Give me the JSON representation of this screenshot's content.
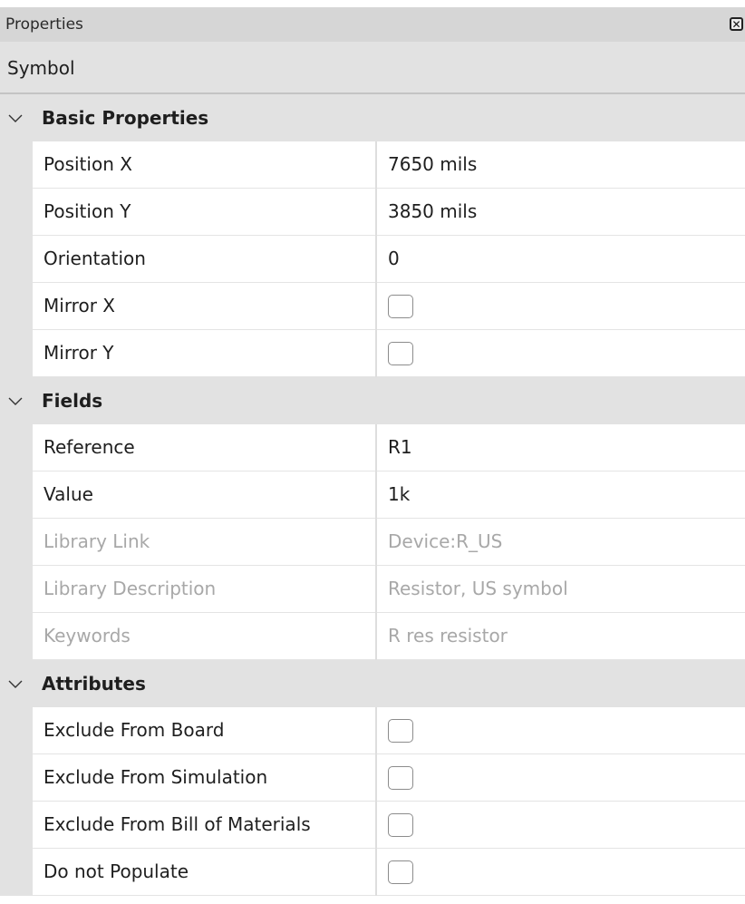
{
  "panel": {
    "title": "Properties",
    "close_icon": "close-icon",
    "subtitle": "Symbol"
  },
  "groups": [
    {
      "label": "Basic Properties",
      "rows": [
        {
          "name": "Position X",
          "value": "7650 mils",
          "type": "text"
        },
        {
          "name": "Position Y",
          "value": "3850 mils",
          "type": "text"
        },
        {
          "name": "Orientation",
          "value": "0",
          "type": "text"
        },
        {
          "name": "Mirror X",
          "checked": false,
          "type": "checkbox"
        },
        {
          "name": "Mirror Y",
          "checked": false,
          "type": "checkbox"
        }
      ]
    },
    {
      "label": "Fields",
      "rows": [
        {
          "name": "Reference",
          "value": "R1",
          "type": "text"
        },
        {
          "name": "Value",
          "value": "1k",
          "type": "text"
        },
        {
          "name": "Library Link",
          "value": "Device:R_US",
          "type": "text",
          "disabled": true
        },
        {
          "name": "Library Description",
          "value": "Resistor, US symbol",
          "type": "text",
          "disabled": true
        },
        {
          "name": "Keywords",
          "value": "R res resistor",
          "type": "text",
          "disabled": true
        }
      ]
    },
    {
      "label": "Attributes",
      "rows": [
        {
          "name": "Exclude From Board",
          "checked": false,
          "type": "checkbox"
        },
        {
          "name": "Exclude From Simulation",
          "checked": false,
          "type": "checkbox"
        },
        {
          "name": "Exclude From Bill of Materials",
          "checked": false,
          "type": "checkbox"
        },
        {
          "name": "Do not Populate",
          "checked": false,
          "type": "checkbox"
        }
      ]
    }
  ],
  "colors": {
    "header_bg": "#d6d6d6",
    "group_bg": "#e2e2e2",
    "disabled_text": "#a8a8a8",
    "text": "#1e1e1e"
  }
}
